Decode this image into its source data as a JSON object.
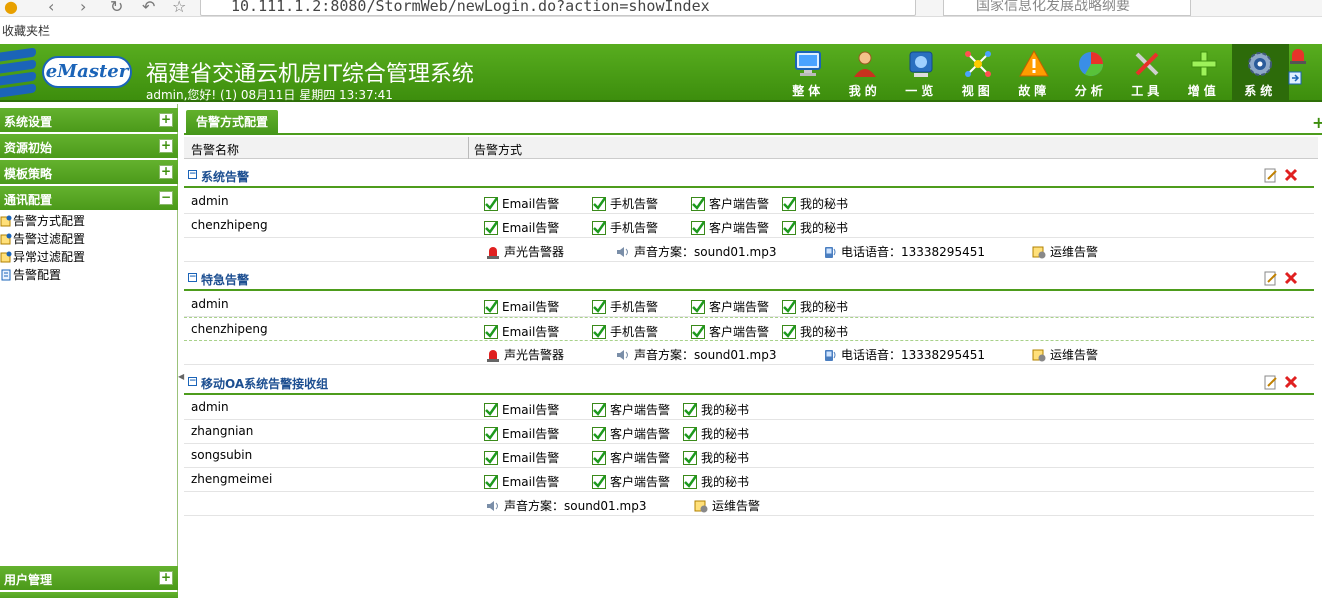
{
  "browser": {
    "url": "10.111.1.2:8080/StormWeb/newLogin.do?action=showIndex",
    "search_placeholder": "国家信息化发展战略纲要",
    "bookmarks_label": "收藏夹栏"
  },
  "header": {
    "logo_text": "eMaster",
    "title": "福建省交通云机房IT综合管理系统",
    "login_info": "admin,您好! (1) 08月11日 星期四 13:37:41",
    "nav": [
      {
        "label": "整体",
        "icon": "monitor-icon"
      },
      {
        "label": "我的",
        "icon": "user-icon"
      },
      {
        "label": "一览",
        "icon": "overview-icon"
      },
      {
        "label": "视图",
        "icon": "topology-icon"
      },
      {
        "label": "故障",
        "icon": "warning-icon"
      },
      {
        "label": "分析",
        "icon": "pie-chart-icon"
      },
      {
        "label": "工具",
        "icon": "tools-icon"
      },
      {
        "label": "增值",
        "icon": "plus-icon"
      },
      {
        "label": "系统",
        "icon": "gear-icon",
        "active": true
      }
    ]
  },
  "sidebar": {
    "groups": [
      {
        "label": "系统设置",
        "toggle": "+"
      },
      {
        "label": "资源初始",
        "toggle": "+"
      },
      {
        "label": "模板策略",
        "toggle": "+"
      },
      {
        "label": "通讯配置",
        "toggle": "−"
      }
    ],
    "items": [
      {
        "label": "告警方式配置"
      },
      {
        "label": "告警过滤配置"
      },
      {
        "label": "异常过滤配置"
      },
      {
        "label": "告警配置"
      }
    ],
    "bottom_group": {
      "label": "用户管理",
      "toggle": "+"
    }
  },
  "main": {
    "tab_label": "告警方式配置",
    "columns": [
      "告警名称",
      "告警方式"
    ],
    "groups": [
      {
        "name": "系统告警",
        "rows": [
          {
            "user": "admin",
            "methods": [
              "Email告警",
              "手机告警",
              "客户端告警",
              "我的秘书"
            ]
          },
          {
            "user": "chenzhipeng",
            "methods": [
              "Email告警",
              "手机告警",
              "客户端告警",
              "我的秘书"
            ]
          }
        ],
        "extra": {
          "alarm": "声光告警器",
          "sound": "声音方案：sound01.mp3",
          "phone": "电话语音：13338295451",
          "ops": "运维告警"
        }
      },
      {
        "name": "特急告警",
        "rows": [
          {
            "user": "admin",
            "methods": [
              "Email告警",
              "手机告警",
              "客户端告警",
              "我的秘书"
            ]
          },
          {
            "user": "chenzhipeng",
            "methods": [
              "Email告警",
              "手机告警",
              "客户端告警",
              "我的秘书"
            ]
          }
        ],
        "extra": {
          "alarm": "声光告警器",
          "sound": "声音方案：sound01.mp3",
          "phone": "电话语音：13338295451",
          "ops": "运维告警"
        }
      },
      {
        "name": "移动OA系统告警接收组",
        "rows": [
          {
            "user": "admin",
            "methods": [
              "Email告警",
              "客户端告警",
              "我的秘书"
            ]
          },
          {
            "user": "zhangnian",
            "methods": [
              "Email告警",
              "客户端告警",
              "我的秘书"
            ]
          },
          {
            "user": "songsubin",
            "methods": [
              "Email告警",
              "客户端告警",
              "我的秘书"
            ]
          },
          {
            "user": "zhengmeimei",
            "methods": [
              "Email告警",
              "客户端告警",
              "我的秘书"
            ]
          }
        ],
        "extra": {
          "sound": "声音方案：sound01.mp3",
          "ops": "运维告警"
        }
      }
    ]
  },
  "colors": {
    "header_green": "#4a9c16",
    "group_title_blue": "#1d4f91",
    "delete_red": "#e02020"
  }
}
